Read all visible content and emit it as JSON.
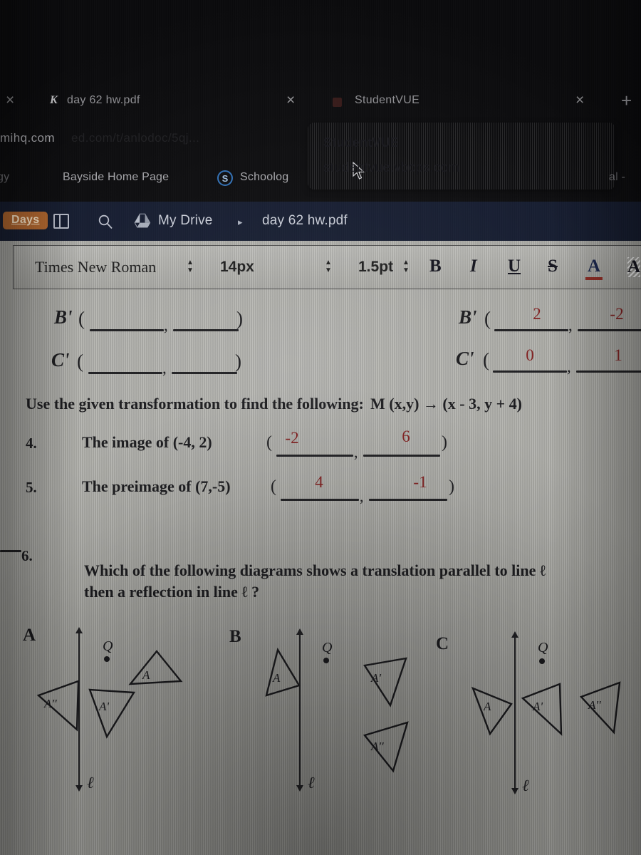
{
  "browser": {
    "tabs": [
      {
        "title": "day 62 hw.pdf",
        "favicon": "kami-k-icon",
        "close_label": "×"
      },
      {
        "title": "StudentVUE",
        "favicon": "studentvue-icon",
        "close_label": "×"
      }
    ],
    "new_tab_label": "+",
    "address_bar": {
      "value": "mihq.com",
      "ghost": "ed.com/t/anlodoc/5qj..."
    },
    "bookmarks": [
      {
        "label": "gy"
      },
      {
        "label": "Bayside Home Page"
      },
      {
        "label": "Schoolog",
        "icon": "schoology-icon",
        "icon_letter": "S"
      },
      {
        "label": "al - "
      }
    ],
    "tooltip": {
      "title": "StudentVUE",
      "url": "studentvue.vbcps.com"
    }
  },
  "appbar": {
    "days_badge": "Days",
    "panel_icon": "sidebar-panel-icon",
    "search_icon": "search-icon",
    "drive_icon": "google-drive-icon",
    "drive_label": "My Drive",
    "breadcrumb_arrow": "▸",
    "filename": "day 62 hw.pdf"
  },
  "toolbar": {
    "font_family": "Times New Roman",
    "font_size": "14px",
    "line_width": "1.5pt",
    "bold": "B",
    "italic": "I",
    "underline": "U",
    "strikethrough": "S",
    "text_color": "A",
    "highlight": "A",
    "stepper_up": "▲",
    "stepper_down": "▼"
  },
  "worksheet": {
    "left_points": [
      {
        "label": "B'",
        "open": "(",
        "x": "",
        "sep": ",",
        "y": "",
        "close": ")"
      },
      {
        "label": "C'",
        "open": "(",
        "x": "",
        "sep": ",",
        "y": "",
        "close": ")"
      }
    ],
    "right_points": [
      {
        "label": "B'",
        "open": "(",
        "x": "2",
        "sep": ",",
        "y": "-2"
      },
      {
        "label": "C'",
        "open": "(",
        "x": "0",
        "sep": ",",
        "y": "1"
      }
    ],
    "instruction": "Use the given transformation to find the following:",
    "rule": "M (x,y)  →  (x - 3, y + 4)",
    "questions": [
      {
        "number": "4.",
        "text": "The image of (-4, 2)",
        "open": "(",
        "answer_x": "-2",
        "sep": ",",
        "answer_y": "6",
        "close": ")"
      },
      {
        "number": "5.",
        "text": "The preimage of (7,-5)",
        "open": "(",
        "answer_x": "4",
        "sep": ",",
        "answer_y": "-1",
        "close": ")"
      }
    ],
    "question6": {
      "number": "6.",
      "line1": "Which of the following diagrams shows a translation parallel to line ℓ",
      "line2": "then a reflection in line  ℓ ?",
      "choices": [
        {
          "letter": "A",
          "line_label": "ℓ",
          "point_label": "Q",
          "triangles": [
            {
              "label": "A"
            },
            {
              "label": "A'"
            },
            {
              "label": "A''"
            }
          ]
        },
        {
          "letter": "B",
          "line_label": "ℓ",
          "point_label": "Q",
          "triangles": [
            {
              "label": "A"
            },
            {
              "label": "A'"
            },
            {
              "label": "A''"
            }
          ]
        },
        {
          "letter": "C",
          "line_label": "ℓ",
          "point_label": "Q",
          "triangles": [
            {
              "label": "A"
            },
            {
              "label": "A'"
            },
            {
              "label": "A''"
            }
          ]
        }
      ]
    }
  },
  "colors": {
    "answer_red": "#7e1b1b",
    "appbar_navy": "#131a2e",
    "days_orange": "#b5672c",
    "paper_grey": "#a9a9a4"
  }
}
